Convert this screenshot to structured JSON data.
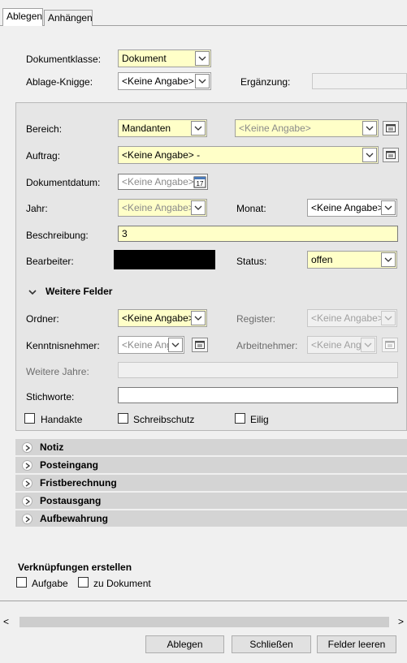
{
  "tabs": [
    {
      "label": "Ablegen"
    },
    {
      "label": "Anhängen"
    }
  ],
  "header": {
    "dokumentklasse_label": "Dokumentklasse:",
    "dokumentklasse_value": "Dokument",
    "ablage_knigge_label": "Ablage-Knigge:",
    "ablage_knigge_value": "<Keine Angabe>",
    "ergaenzung_label": "Ergänzung:",
    "ergaenzung_value": ""
  },
  "form": {
    "bereich_label": "Bereich:",
    "bereich_value": "Mandanten",
    "bereich2_value": "<Keine Angabe>",
    "auftrag_label": "Auftrag:",
    "auftrag_value": "<Keine Angabe> -",
    "dokumentdatum_label": "Dokumentdatum:",
    "dokumentdatum_value": "<Keine Angabe>",
    "calendar_day": "17",
    "jahr_label": "Jahr:",
    "jahr_value": "<Keine Angabe>",
    "monat_label": "Monat:",
    "monat_value": "<Keine Angabe>",
    "beschreibung_label": "Beschreibung:",
    "beschreibung_value": "3",
    "bearbeiter_label": "Bearbeiter:",
    "status_label": "Status:",
    "status_value": "offen"
  },
  "weitere": {
    "title": "Weitere Felder",
    "ordner_label": "Ordner:",
    "ordner_value": "<Keine Angabe>",
    "register_label": "Register:",
    "register_value": "<Keine Angabe>",
    "kenntnisnehmer_label": "Kenntnisnehmer:",
    "kenntnisnehmer_value": "<Keine Anga",
    "arbeitnehmer_label": "Arbeitnehmer:",
    "arbeitnehmer_value": "<Keine Anga",
    "weitere_jahre_label": "Weitere Jahre:",
    "stichworte_label": "Stichworte:",
    "checkboxes": [
      {
        "label": "Handakte"
      },
      {
        "label": "Schreibschutz"
      },
      {
        "label": "Eilig"
      }
    ]
  },
  "sections": [
    {
      "label": "Notiz"
    },
    {
      "label": "Posteingang"
    },
    {
      "label": "Fristberechnung"
    },
    {
      "label": "Postausgang"
    },
    {
      "label": "Aufbewahrung"
    }
  ],
  "verknuepfungen": {
    "title": "Verknüpfungen erstellen",
    "items": [
      {
        "label": "Aufgabe"
      },
      {
        "label": "zu Dokument"
      }
    ]
  },
  "scroll": {
    "left": "<",
    "right": ">"
  },
  "buttons": {
    "ablegen": "Ablegen",
    "schliessen": "Schließen",
    "felder_leeren": "Felder leeren"
  },
  "colors": {
    "field_yellow": "#ffffc8",
    "section_bg": "#d4d4d4",
    "panel_bg": "#e6e6e6",
    "redacted": "#000000"
  }
}
